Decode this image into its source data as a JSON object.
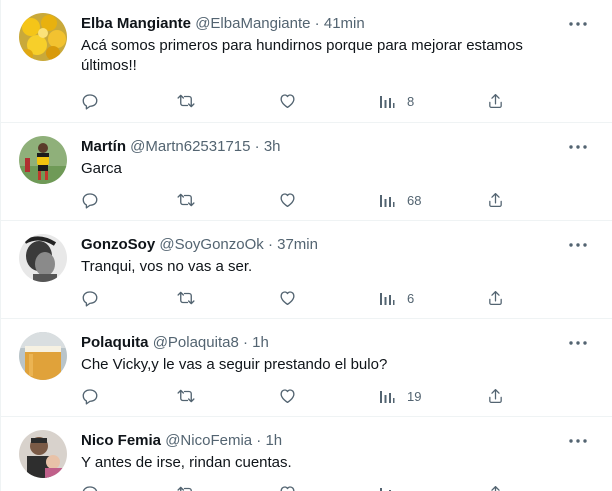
{
  "tweets": [
    {
      "name": "Elba Mangiante",
      "handle": "@ElbaMangiante",
      "time": "41min",
      "text": "Acá somos primeros para hundirnos porque para mejorar estamos últimos!!",
      "views": "8",
      "avatar": "yellow-flowers-avatar"
    },
    {
      "name": "Martín",
      "handle": "@Martn62531715",
      "time": "3h",
      "text": "Garca",
      "views": "68",
      "avatar": "soccer-player-avatar"
    },
    {
      "name": "GonzoSoy",
      "handle": "@SoyGonzoOk",
      "time": "37min",
      "text": "Tranqui, vos no vas a ser.",
      "views": "6",
      "avatar": "grayscale-portrait-avatar"
    },
    {
      "name": "Polaquita",
      "handle": "@Polaquita8",
      "time": "1h",
      "text": "Che Vicky,y le vas a seguir prestando el bulo?",
      "views": "19",
      "avatar": "beer-glass-avatar"
    },
    {
      "name": "Nico Femia",
      "handle": "@NicoFemia",
      "time": "1h",
      "text": "Y antes de irse, rindan cuentas.",
      "views": "",
      "avatar": "man-with-child-avatar"
    }
  ],
  "separator": " · ",
  "colors": {
    "text": "#0f1419",
    "secondary": "#536471",
    "border": "#eff3f4"
  },
  "icons": {
    "reply": "reply-icon",
    "retweet": "retweet-icon",
    "like": "heart-icon",
    "views": "views-chart-icon",
    "share": "share-icon",
    "more": "more-dots-icon"
  }
}
